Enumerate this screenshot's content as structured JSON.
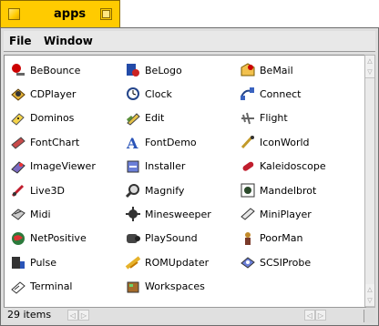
{
  "window": {
    "title": "apps",
    "accent_color": "#ffcb00"
  },
  "menubar": {
    "items": [
      "File",
      "Window"
    ]
  },
  "apps": [
    {
      "label": "BeBounce",
      "icon": "bebounce-icon"
    },
    {
      "label": "BeLogo",
      "icon": "belogo-icon"
    },
    {
      "label": "BeMail",
      "icon": "bemail-icon"
    },
    {
      "label": "CDPlayer",
      "icon": "cdplayer-icon"
    },
    {
      "label": "Clock",
      "icon": "clock-icon"
    },
    {
      "label": "Connect",
      "icon": "connect-icon"
    },
    {
      "label": "Dominos",
      "icon": "dominos-icon"
    },
    {
      "label": "Edit",
      "icon": "edit-icon"
    },
    {
      "label": "Flight",
      "icon": "flight-icon"
    },
    {
      "label": "FontChart",
      "icon": "fontchart-icon"
    },
    {
      "label": "FontDemo",
      "icon": "fontdemo-icon"
    },
    {
      "label": "IconWorld",
      "icon": "iconworld-icon"
    },
    {
      "label": "ImageViewer",
      "icon": "imageviewer-icon"
    },
    {
      "label": "Installer",
      "icon": "installer-icon"
    },
    {
      "label": "Kaleidoscope",
      "icon": "kaleidoscope-icon"
    },
    {
      "label": "Live3D",
      "icon": "live3d-icon"
    },
    {
      "label": "Magnify",
      "icon": "magnify-icon"
    },
    {
      "label": "Mandelbrot",
      "icon": "mandelbrot-icon"
    },
    {
      "label": "Midi",
      "icon": "midi-icon"
    },
    {
      "label": "Minesweeper",
      "icon": "minesweeper-icon"
    },
    {
      "label": "MiniPlayer",
      "icon": "miniplayer-icon"
    },
    {
      "label": "NetPositive",
      "icon": "netpositive-icon"
    },
    {
      "label": "PlaySound",
      "icon": "playsound-icon"
    },
    {
      "label": "PoorMan",
      "icon": "poorman-icon"
    },
    {
      "label": "Pulse",
      "icon": "pulse-icon"
    },
    {
      "label": "ROMUpdater",
      "icon": "romupdater-icon"
    },
    {
      "label": "SCSIProbe",
      "icon": "scsiprobe-icon"
    },
    {
      "label": "Terminal",
      "icon": "terminal-icon"
    },
    {
      "label": "Workspaces",
      "icon": "workspaces-icon"
    }
  ],
  "status": {
    "count_text": "29 items"
  }
}
